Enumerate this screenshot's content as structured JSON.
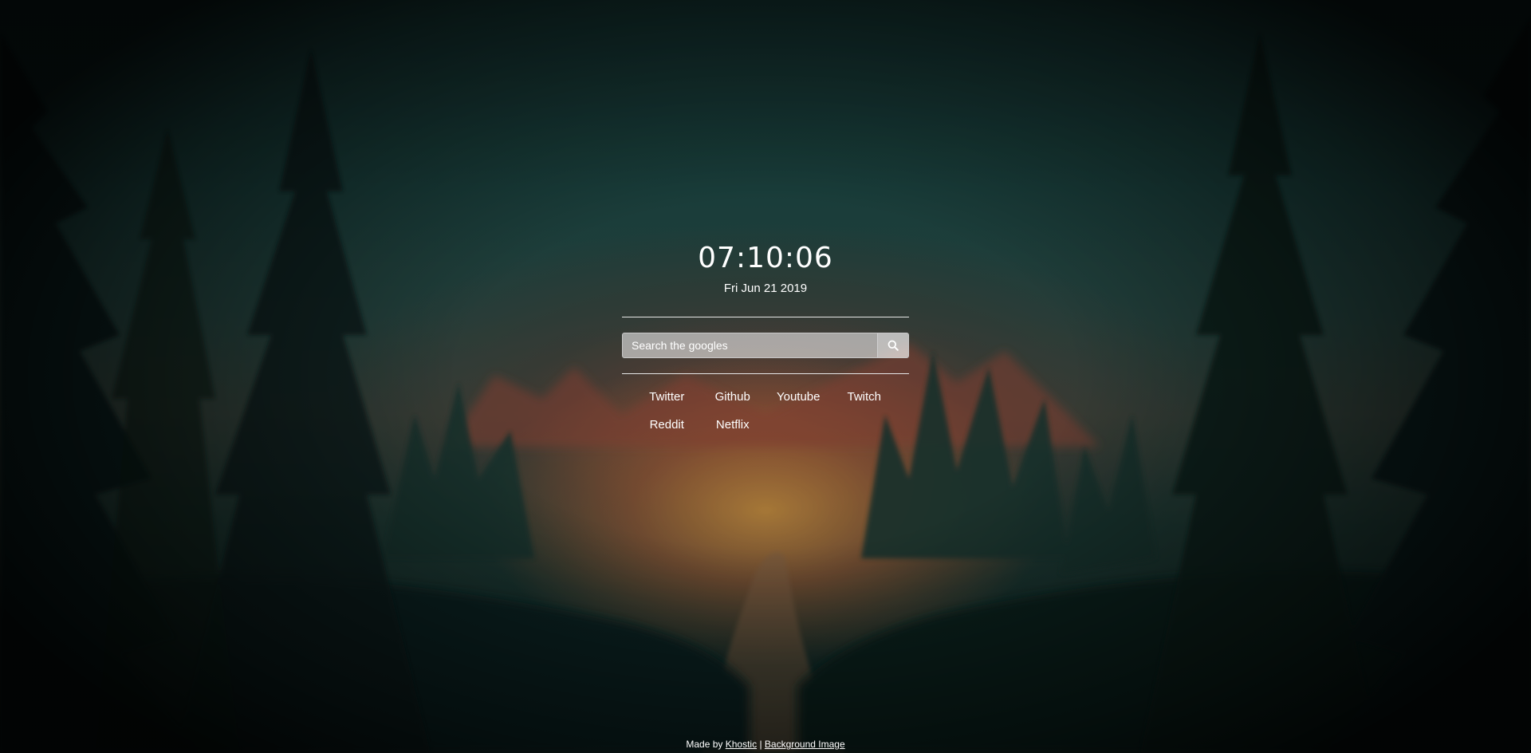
{
  "clock": {
    "time": "07:10:06",
    "date": "Fri Jun 21 2019"
  },
  "search": {
    "placeholder": "Search the googles",
    "value": "",
    "button_icon": "search-icon"
  },
  "links": [
    {
      "label": "Twitter"
    },
    {
      "label": "Github"
    },
    {
      "label": "Youtube"
    },
    {
      "label": "Twitch"
    },
    {
      "label": "Reddit"
    },
    {
      "label": "Netflix"
    }
  ],
  "footer": {
    "made_by": "Made by",
    "author": "Khostic",
    "separator": "|",
    "background_link": "Background Image"
  },
  "colors": {
    "text": "#ffffff",
    "sky_top": "#173a38",
    "sunset": "#e2a046",
    "forest": "#0f2826"
  }
}
